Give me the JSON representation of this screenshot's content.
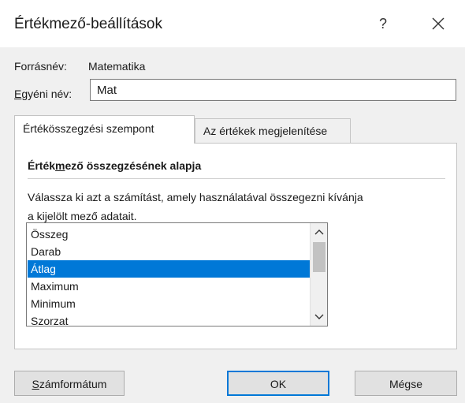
{
  "dialog": {
    "title": "Értékmező-beállítások",
    "help_label": "?",
    "close_icon": "close-icon"
  },
  "source": {
    "label": "Forrásnév:",
    "value": "Matematika"
  },
  "custom_name": {
    "label_underlined": "E",
    "label_rest": "gyéni név:",
    "value": "Mat"
  },
  "tabs": [
    {
      "label": "Értékösszegzési szempont",
      "active": true
    },
    {
      "label": "Az értékek megjelenítése",
      "active": false
    }
  ],
  "summary": {
    "heading_pre": "Érték",
    "heading_underlined": "m",
    "heading_post": "ező összegzésének alapja",
    "description_line1": "Válassza ki azt a számítást, amely használatával összegezni kívánja",
    "description_line2": "a kijelölt mező adatait.",
    "functions": [
      "Összeg",
      "Darab",
      "Átlag",
      "Maximum",
      "Minimum",
      "Szorzat"
    ],
    "selected": "Átlag"
  },
  "buttons": {
    "number_format_underlined": "S",
    "number_format_rest": "zámformátum",
    "ok": "OK",
    "cancel": "Mégse"
  },
  "colors": {
    "selection": "#0078d7",
    "dialog_bg": "#f0f0f0"
  }
}
